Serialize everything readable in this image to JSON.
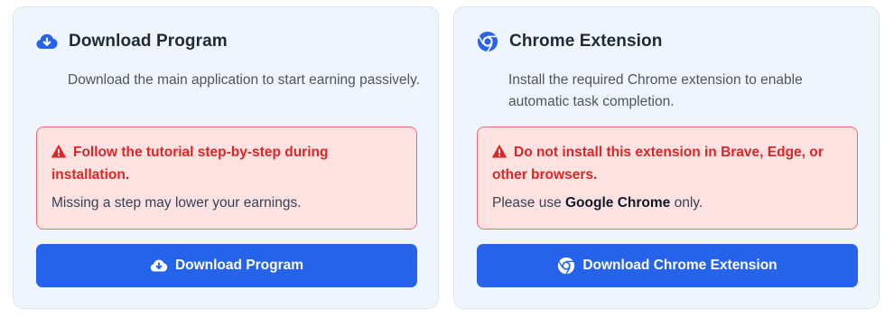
{
  "colors": {
    "accent": "#2563eb",
    "warning_text": "#dc2626",
    "warning_bg": "#fde2e2",
    "card_bg": "#eef5fd"
  },
  "cards": [
    {
      "title": "Download Program",
      "icon": "cloud-download-icon",
      "description": "Download the main application to start earning passively.",
      "warning": {
        "title": "Follow the tutorial step-by-step during installation.",
        "note": "Missing a step may lower your earnings."
      },
      "button": {
        "label": "Download Program",
        "icon": "cloud-download-icon"
      }
    },
    {
      "title": "Chrome Extension",
      "icon": "chrome-icon",
      "description": "Install the required Chrome extension to enable automatic task completion.",
      "warning": {
        "title": "Do not install this extension in Brave, Edge, or other browsers.",
        "note_prefix": "Please use ",
        "note_emphasis": "Google Chrome",
        "note_suffix": " only."
      },
      "button": {
        "label": "Download Chrome Extension",
        "icon": "chrome-icon"
      }
    }
  ]
}
